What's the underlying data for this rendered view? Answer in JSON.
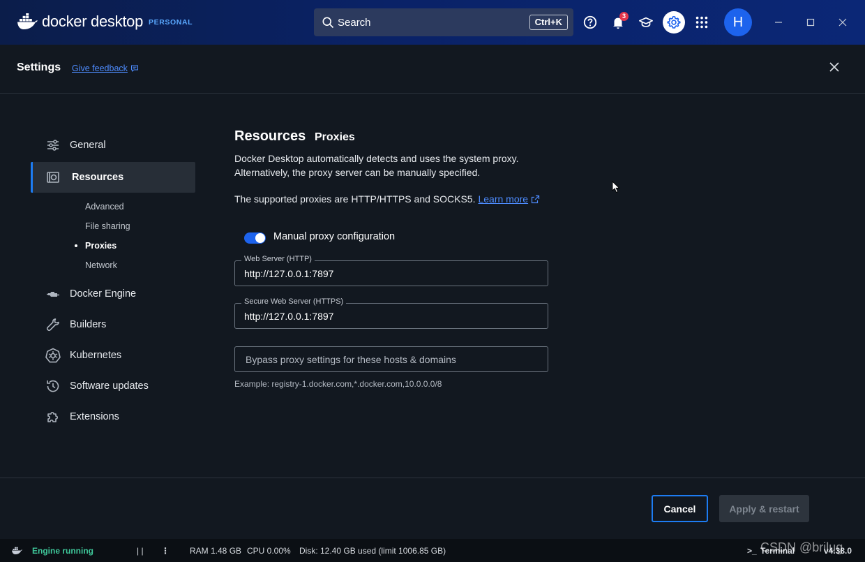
{
  "app": {
    "logo_text": "docker desktop",
    "plan_badge": "PERSONAL"
  },
  "topbar": {
    "search_label": "Search",
    "search_shortcut": "Ctrl+K",
    "notification_count": "3",
    "avatar_initial": "H"
  },
  "settings_header": {
    "title": "Settings",
    "feedback_link": "Give feedback"
  },
  "sidebar": {
    "items": [
      {
        "label": "General",
        "icon": "sliders-icon"
      },
      {
        "label": "Resources",
        "icon": "resources-icon",
        "active": true
      },
      {
        "label": "Docker Engine",
        "icon": "engine-icon"
      },
      {
        "label": "Builders",
        "icon": "wrench-icon"
      },
      {
        "label": "Kubernetes",
        "icon": "kubernetes-icon"
      },
      {
        "label": "Software updates",
        "icon": "clock-icon"
      },
      {
        "label": "Extensions",
        "icon": "puzzle-icon"
      }
    ],
    "resources_subitems": [
      {
        "label": "Advanced"
      },
      {
        "label": "File sharing"
      },
      {
        "label": "Proxies",
        "active": true
      },
      {
        "label": "Network"
      }
    ]
  },
  "main": {
    "title": "Resources",
    "subtitle": "Proxies",
    "description_line1": "Docker Desktop automatically detects and uses the system proxy.",
    "description_line2": "Alternatively, the proxy server can be manually specified.",
    "supported_text": "The supported proxies are HTTP/HTTPS and SOCKS5.",
    "learn_more": "Learn more",
    "manual_proxy_label": "Manual proxy configuration",
    "manual_proxy_enabled": true,
    "http_label": "Web Server (HTTP)",
    "http_value": "http://127.0.0.1:7897",
    "https_label": "Secure Web Server (HTTPS)",
    "https_value": "http://127.0.0.1:7897",
    "bypass_placeholder": "Bypass proxy settings for these hosts & domains",
    "bypass_example": "Example: registry-1.docker.com,*.docker.com,10.0.0.0/8"
  },
  "footer": {
    "cancel_label": "Cancel",
    "apply_label": "Apply & restart"
  },
  "statusbar": {
    "engine_status": "Engine running",
    "pause_glyph": "| |",
    "more_glyph": "⋮",
    "ram": "RAM 1.48 GB",
    "cpu": "CPU 0.00%",
    "disk": "Disk: 12.40 GB used (limit 1006.85 GB)",
    "terminal_label": "Terminal",
    "version": "v4.38.0"
  },
  "watermark": "CSDN @brilug",
  "colors": {
    "accent": "#1d63ed",
    "engine_running": "#3fc79a",
    "notification": "#e0364c",
    "link": "#4e8cff"
  }
}
